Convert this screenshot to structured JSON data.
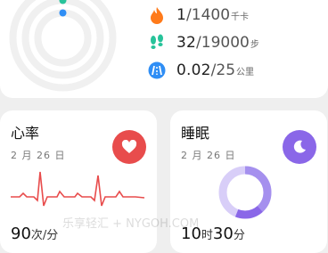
{
  "activity": {
    "stats": [
      {
        "icon": "flame-icon",
        "value": "1",
        "goal": "/1400",
        "unit": "千卡",
        "color": "#ff7a1a"
      },
      {
        "icon": "footprints-icon",
        "value": "32",
        "goal": "/19000",
        "unit": "步",
        "color": "#27c39a"
      },
      {
        "icon": "distance-icon",
        "value": "0.02",
        "goal": "/25",
        "unit": "公里",
        "color": "#2f8ef5"
      }
    ]
  },
  "heart": {
    "title": "心率",
    "date": "2 月 26 日",
    "value": "90",
    "unit": "次/分",
    "color": "#e84c4c"
  },
  "sleep": {
    "title": "睡眠",
    "date": "2 月 26 日",
    "hours": "10",
    "hours_unit": "时",
    "minutes": "30",
    "minutes_unit": "分",
    "color": "#8a67e8"
  },
  "watermark": "乐享轻汇 + NYGOH.COM"
}
